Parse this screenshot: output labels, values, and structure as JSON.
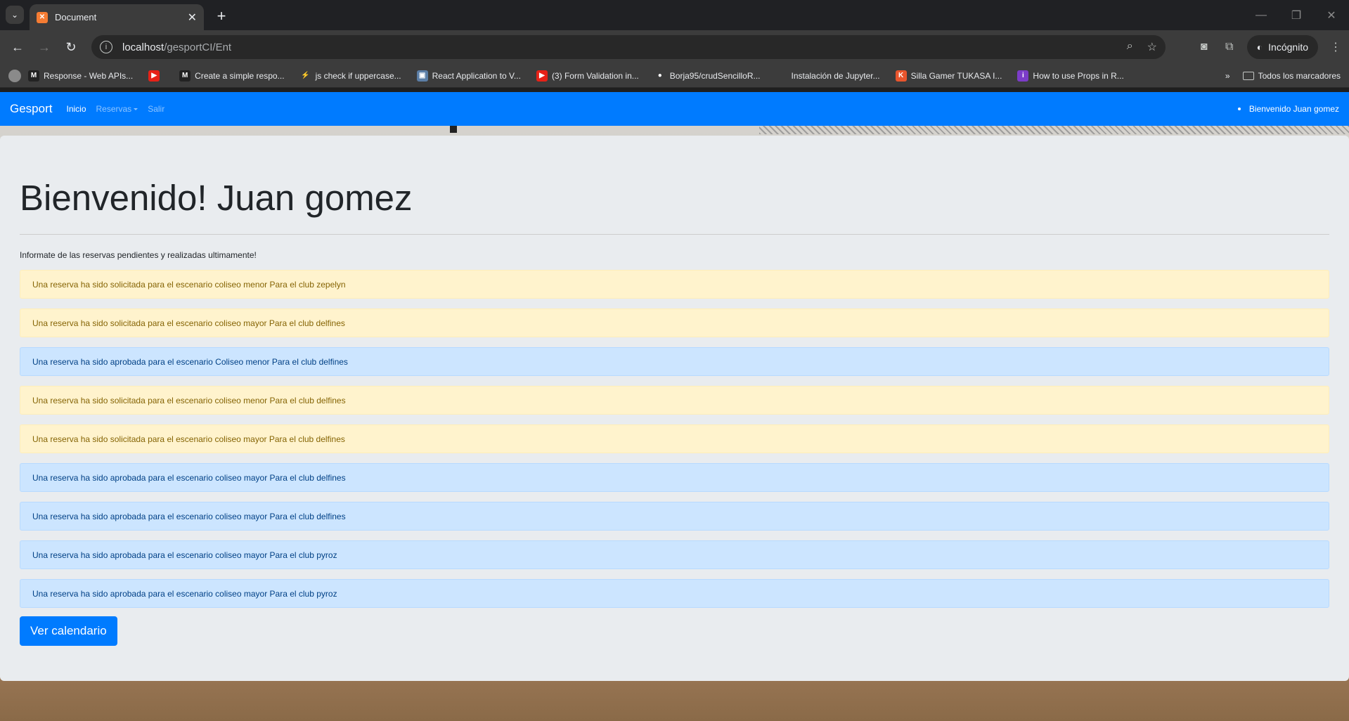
{
  "browser": {
    "tab_title": "Document",
    "url_host": "localhost",
    "url_path": "/gesportCI/Ent",
    "incognito_label": "Incógnito",
    "bookmarks": [
      {
        "label": "Response - Web APIs...",
        "icon_letter": "M",
        "color": "#222"
      },
      {
        "label": "",
        "icon_letter": "▶",
        "color": "#e62117"
      },
      {
        "label": "Create a simple respo...",
        "icon_letter": "M",
        "color": "#222"
      },
      {
        "label": "js check if uppercase...",
        "icon_letter": "⚡",
        "color": "#3c3c3c"
      },
      {
        "label": "React Application to V...",
        "icon_letter": "▣",
        "color": "#5b7ea6"
      },
      {
        "label": "(3) Form Validation in...",
        "icon_letter": "▶",
        "color": "#e62117"
      },
      {
        "label": "Borja95/crudSencilloR...",
        "icon_letter": "●",
        "color": "#3c3c3c"
      },
      {
        "label": "Instalación de Jupyter...",
        "icon_letter": "",
        "color": "#3c3c3c"
      },
      {
        "label": "Silla Gamer TUKASA I...",
        "icon_letter": "K",
        "color": "#e8552d"
      },
      {
        "label": "How to use Props in R...",
        "icon_letter": "i",
        "color": "#7c3cc9"
      }
    ],
    "all_bookmarks_label": "Todos los marcadores"
  },
  "navbar": {
    "brand": "Gesport",
    "links": {
      "inicio": "Inicio",
      "reservas": "Reservas",
      "salir": "Salir"
    },
    "welcome": "Bienvenido Juan gomez"
  },
  "jumbotron": {
    "title": "Bienvenido! Juan gomez",
    "lead": "Informate de las reservas pendientes y realizadas ultimamente!",
    "alerts": [
      {
        "type": "warning",
        "text": "Una reserva ha sido solicitada para el escenario coliseo menor Para el club zepelyn"
      },
      {
        "type": "warning",
        "text": "Una reserva ha sido solicitada para el escenario coliseo mayor Para el club delfines"
      },
      {
        "type": "info",
        "text": "Una reserva ha sido aprobada para el escenario Coliseo menor Para el club delfines"
      },
      {
        "type": "warning",
        "text": "Una reserva ha sido solicitada para el escenario coliseo menor Para el club delfines"
      },
      {
        "type": "warning",
        "text": "Una reserva ha sido solicitada para el escenario coliseo mayor Para el club delfines"
      },
      {
        "type": "info",
        "text": "Una reserva ha sido aprobada para el escenario coliseo mayor Para el club delfines"
      },
      {
        "type": "info",
        "text": "Una reserva ha sido aprobada para el escenario coliseo mayor Para el club delfines"
      },
      {
        "type": "info",
        "text": "Una reserva ha sido aprobada para el escenario coliseo mayor Para el club pyroz"
      },
      {
        "type": "info",
        "text": "Una reserva ha sido aprobada para el escenario coliseo mayor Para el club pyroz"
      }
    ],
    "button_label": "Ver calendario"
  }
}
